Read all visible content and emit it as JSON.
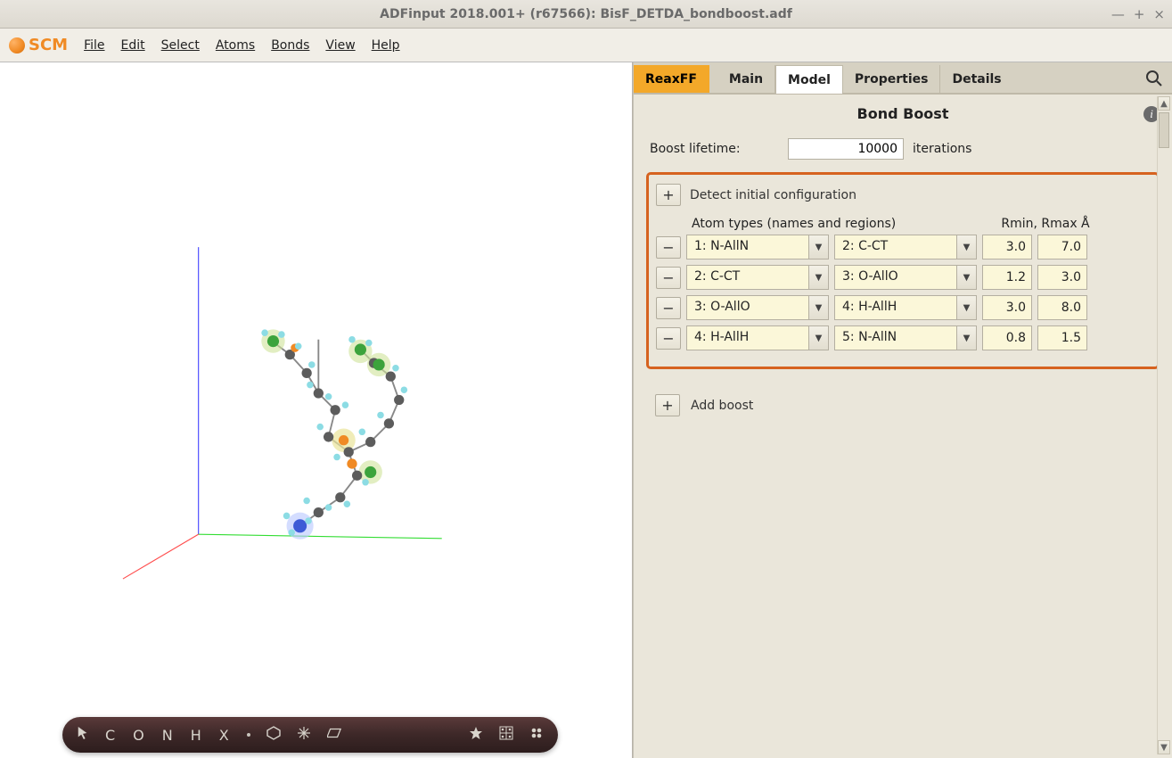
{
  "window": {
    "title": "ADFinput 2018.001+ (r67566): BisF_DETDA_bondboost.adf",
    "controls": {
      "min": "—",
      "max": "+",
      "close": "×"
    }
  },
  "logo_text": "SCM",
  "menu": [
    "File",
    "Edit",
    "Select",
    "Atoms",
    "Bonds",
    "View",
    "Help"
  ],
  "element_bar": {
    "elements": [
      "C",
      "O",
      "N",
      "H",
      "X"
    ]
  },
  "tabs": [
    "ReaxFF",
    "Main",
    "Model",
    "Properties",
    "Details"
  ],
  "panel": {
    "title": "Bond Boost",
    "boost_lifetime_label": "Boost lifetime:",
    "boost_lifetime_value": "10000",
    "boost_lifetime_unit": "iterations",
    "detect_label": "Detect initial configuration",
    "col_header_types": "Atom types (names and regions)",
    "col_header_r": "Rmin, Rmax Å",
    "rows": [
      {
        "a": "1: N-AllN",
        "b": "2: C-CT",
        "rmin": "3.0",
        "rmax": "7.0"
      },
      {
        "a": "2: C-CT",
        "b": "3: O-AllO",
        "rmin": "1.2",
        "rmax": "3.0"
      },
      {
        "a": "3: O-AllO",
        "b": "4: H-AllH",
        "rmin": "3.0",
        "rmax": "8.0"
      },
      {
        "a": "4: H-AllH",
        "b": "5: N-AllN",
        "rmin": "0.8",
        "rmax": "1.5"
      }
    ],
    "add_boost_label": "Add boost",
    "plus": "+",
    "minus": "−"
  }
}
